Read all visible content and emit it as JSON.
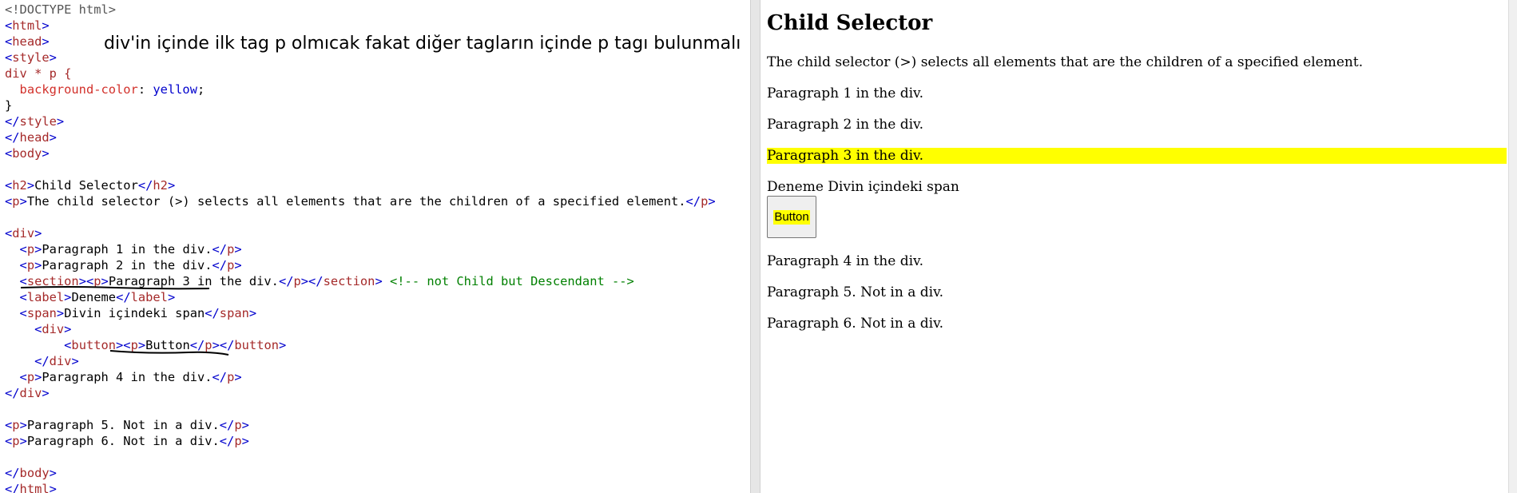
{
  "annotation": "div'in içinde ilk tag p olmıcak fakat diğer tagların içinde p tagı bulunmalı",
  "code": {
    "doctype": "<!DOCTYPE html>",
    "css_selector": "div * p {",
    "css_prop": "background-color",
    "css_val": "yellow",
    "h2_text": "Child Selector",
    "p_intro": "The child selector (>) selects all elements that are the children of a specified element.",
    "p1": "Paragraph 1 in the div.",
    "p2": "Paragraph 2 in the div.",
    "p3": "Paragraph 3 in the div.",
    "comment": "<!-- not Child but Descendant -->",
    "label_text": "Deneme",
    "span_text": "Divin içindeki span",
    "button_text": "Button",
    "p4": "Paragraph 4 in the div.",
    "p5": "Paragraph 5. Not in a div.",
    "p6": "Paragraph 6. Not in a div."
  },
  "result": {
    "title": "Child Selector",
    "intro": "The child selector (>) selects all elements that are the children of a specified element.",
    "p1": "Paragraph 1 in the div.",
    "p2": "Paragraph 2 in the div.",
    "p3": "Paragraph 3 in the div.",
    "span_line": "Deneme Divin içindeki span",
    "button_label": "Button",
    "p4": "Paragraph 4 in the div.",
    "p5": "Paragraph 5. Not in a div.",
    "p6": "Paragraph 6. Not in a div.",
    "highlight_color": "#ffff00"
  }
}
